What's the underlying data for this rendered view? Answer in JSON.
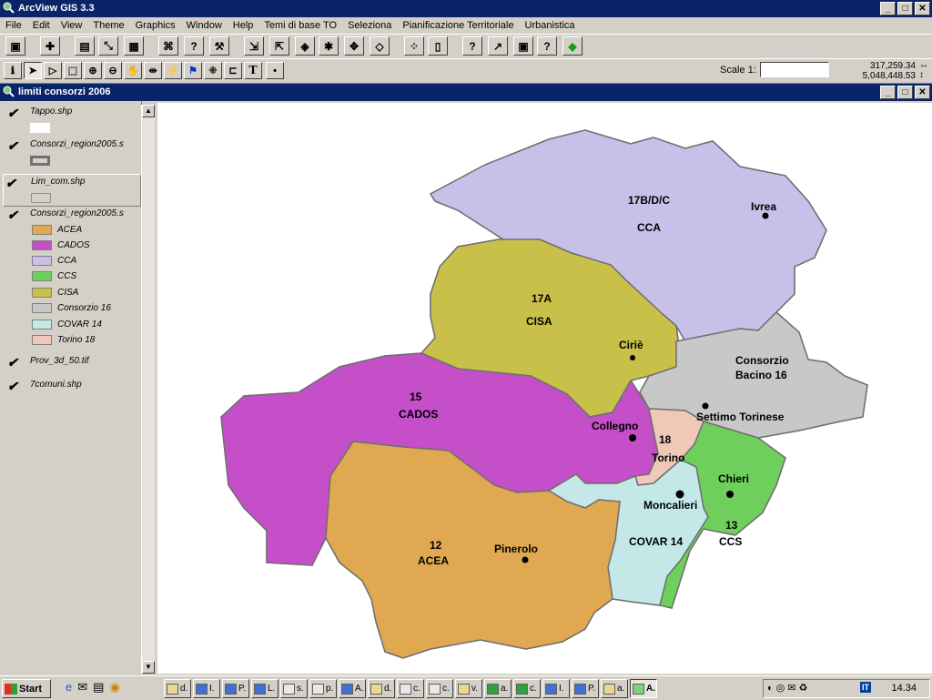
{
  "app": {
    "title": "ArcView GIS 3.3"
  },
  "menu": [
    "File",
    "Edit",
    "View",
    "Theme",
    "Graphics",
    "Window",
    "Help",
    "Temi di base TO",
    "Seleziona",
    "Pianificazione Territoriale",
    "Urbanistica"
  ],
  "toolbar": {
    "scale_label": "Scale 1:",
    "scale_value": "",
    "coord_x": "317,259.34",
    "coord_y": "5,048,448.53"
  },
  "view": {
    "title": "limiti consorzi 2006"
  },
  "toc": {
    "layers": [
      {
        "name": "Tappo.shp"
      },
      {
        "name": "Consorzi_region2005.s"
      },
      {
        "name": "Lim_com.shp"
      },
      {
        "name": "Consorzi_region2005.s"
      },
      {
        "name": "Prov_3d_50.tif"
      },
      {
        "name": "7comuni.shp"
      }
    ],
    "classes": [
      {
        "name": "ACEA",
        "color": "#e0a850"
      },
      {
        "name": "CADOS",
        "color": "#c44fc8"
      },
      {
        "name": "CCA",
        "color": "#c8c0e8"
      },
      {
        "name": "CCS",
        "color": "#6fcf5c"
      },
      {
        "name": "CISA",
        "color": "#c8c048"
      },
      {
        "name": "Consorzio 16",
        "color": "#c8c8c8"
      },
      {
        "name": "COVAR 14",
        "color": "#c4e8e8"
      },
      {
        "name": "Torino 18",
        "color": "#f0c8b8"
      }
    ]
  },
  "map": {
    "labels": {
      "cca_code": "17B/D/C",
      "cca": "CCA",
      "ivrea": "Ivrea",
      "cisa_code": "17A",
      "cisa": "CISA",
      "cirie": "Ciriè",
      "cons16_a": "Consorzio",
      "cons16_b": "Bacino 16",
      "settimo": "Settimo Torinese",
      "cados_code": "15",
      "cados": "CADOS",
      "collegno": "Collegno",
      "torino_code": "18",
      "torino": "Torino",
      "chieri": "Chieri",
      "moncalieri": "Moncalieri",
      "ccs_code": "13",
      "ccs": "CCS",
      "covar": "COVAR 14",
      "acea_code": "12",
      "acea": "ACEA",
      "pinerolo": "Pinerolo"
    }
  },
  "taskbar": {
    "start": "Start",
    "tasks": [
      "d.",
      "I.",
      "P.",
      "L.",
      "s.",
      "p.",
      "A.",
      "d.",
      "c.",
      "c.",
      "v.",
      "a.",
      "c.",
      "I.",
      "P.",
      "a.",
      "A."
    ],
    "clock": "14.34",
    "tray_lang": "IT"
  },
  "colors": {
    "titlebar": "#0a246a",
    "face": "#d4d0c8"
  }
}
